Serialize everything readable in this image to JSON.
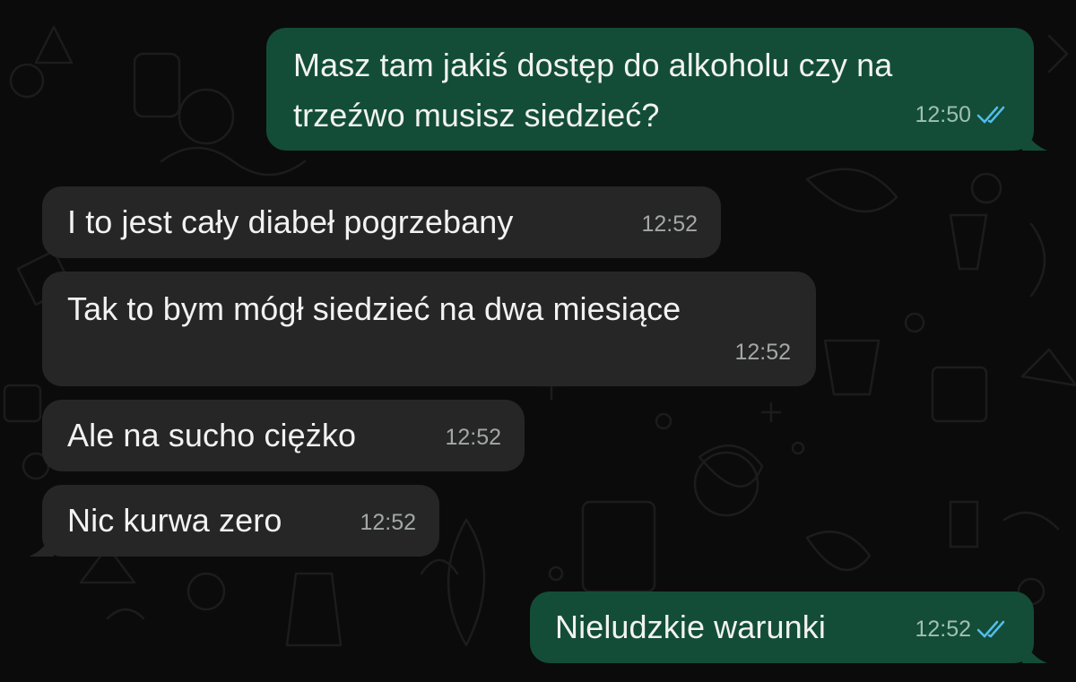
{
  "messages": [
    {
      "direction": "outgoing",
      "lines": [
        "Masz tam jakiś dostęp do alkoholu czy na",
        "trzeźwo musisz siedzieć?"
      ],
      "time": "12:50",
      "status_icon": "double-check-icon"
    },
    {
      "direction": "incoming",
      "lines": [
        "I to jest cały diabeł pogrzebany"
      ],
      "time": "12:52"
    },
    {
      "direction": "incoming",
      "lines": [
        "Tak to bym mógł siedzieć na dwa miesiące"
      ],
      "time": "12:52"
    },
    {
      "direction": "incoming",
      "lines": [
        "Ale na sucho ciężko"
      ],
      "time": "12:52"
    },
    {
      "direction": "incoming",
      "lines": [
        "Nic kurwa zero"
      ],
      "time": "12:52"
    },
    {
      "direction": "outgoing",
      "lines": [
        "Nieludzkie warunki"
      ],
      "time": "12:52",
      "status_icon": "double-check-icon"
    }
  ],
  "colors": {
    "background": "#0b0b0b",
    "incoming_bubble": "#262626",
    "outgoing_bubble": "#134d37",
    "read_check": "#53bdeb"
  }
}
